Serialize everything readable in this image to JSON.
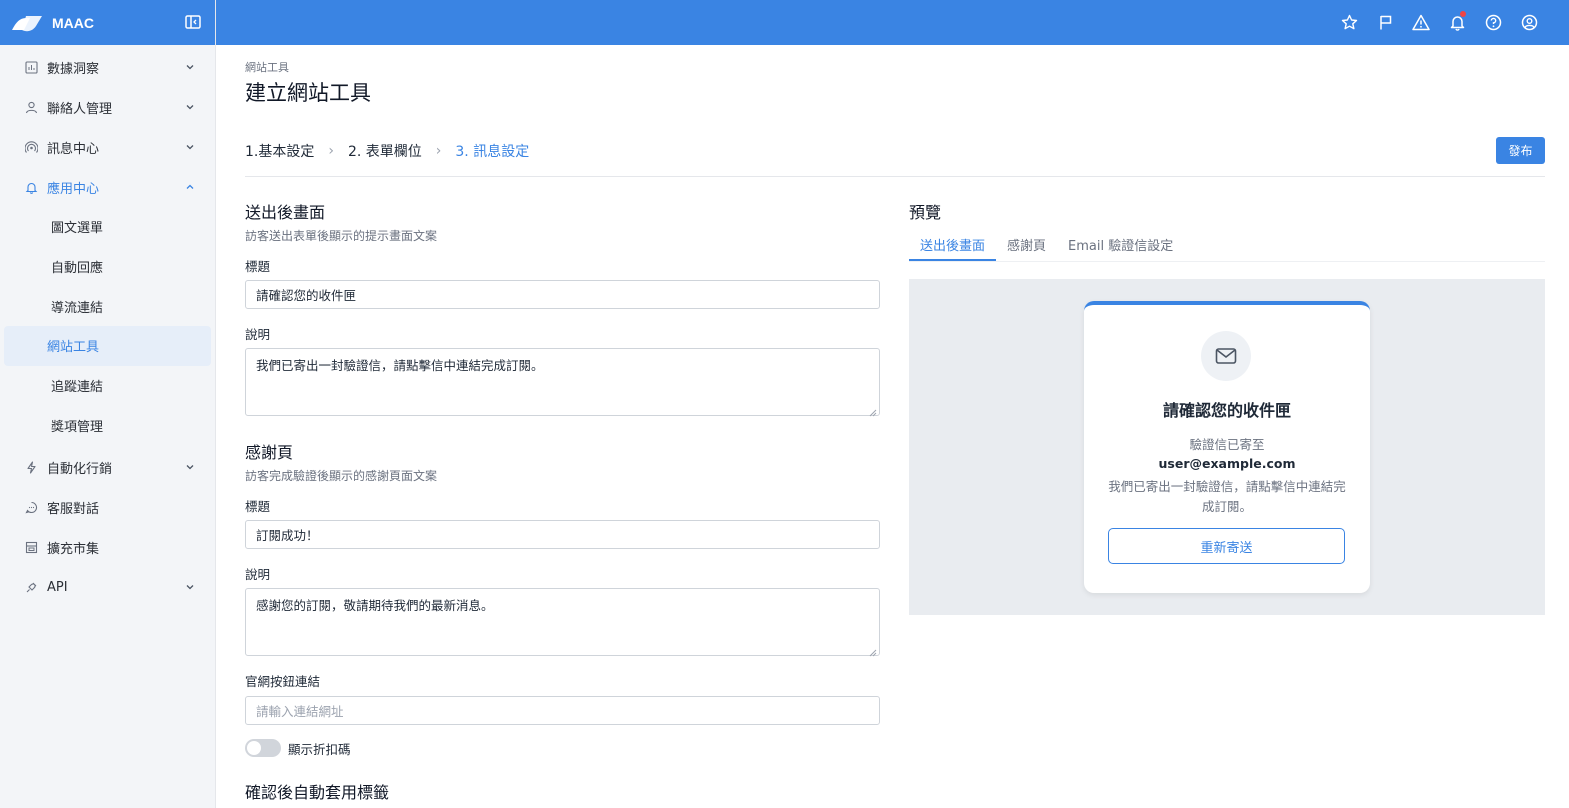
{
  "app": {
    "name": "MAAC"
  },
  "sidebar": {
    "items": [
      {
        "label": "數據洞察",
        "icon": "chart-icon"
      },
      {
        "label": "聯絡人管理",
        "icon": "user-icon"
      },
      {
        "label": "訊息中心",
        "icon": "broadcast-icon"
      },
      {
        "label": "應用中心",
        "icon": "bell-icon"
      },
      {
        "label": "自動化行銷",
        "icon": "lightning-icon"
      },
      {
        "label": "客服對話",
        "icon": "chat-icon"
      },
      {
        "label": "擴充市集",
        "icon": "store-icon"
      },
      {
        "label": "API",
        "icon": "plug-icon"
      }
    ],
    "sub_items": [
      {
        "label": "圖文選單"
      },
      {
        "label": "自動回應"
      },
      {
        "label": "導流連結"
      },
      {
        "label": "網站工具"
      },
      {
        "label": "追蹤連結"
      },
      {
        "label": "獎項管理"
      }
    ]
  },
  "topbar": {
    "icons": [
      "star-icon",
      "flag-icon",
      "warning-icon",
      "bell-icon",
      "help-icon",
      "account-icon"
    ]
  },
  "page": {
    "breadcrumb": "網站工具",
    "title": "建立網站工具",
    "steps": [
      "1.基本設定",
      "2. 表單欄位",
      "3. 訊息設定"
    ],
    "publish_label": "發布"
  },
  "form": {
    "after_submit": {
      "title": "送出後畫面",
      "desc": "訪客送出表單後顯示的提示畫面文案",
      "title_label": "標題",
      "title_value": "請確認您的收件匣",
      "desc_label": "說明",
      "desc_value": "我們已寄出一封驗證信，請點擊信中連結完成訂閱。"
    },
    "thanks": {
      "title": "感謝頁",
      "desc": "訪客完成驗證後顯示的感謝頁面文案",
      "title_label": "標題",
      "title_value": "訂閱成功！",
      "desc_label": "說明",
      "desc_value": "感謝您的訂閱，敬請期待我們的最新消息。",
      "link_label": "官網按鈕連結",
      "link_placeholder": "請輸入連結網址",
      "toggle_label": "顯示折扣碼",
      "toggle_on": false
    },
    "auto_tag_title": "確認後自動套用標籤"
  },
  "preview": {
    "title": "預覽",
    "tabs": [
      "送出後畫面",
      "感謝頁",
      "Email 驗證信設定"
    ],
    "active_tab": 0,
    "card": {
      "title": "請確認您的收件匣",
      "sub": "驗證信已寄至",
      "email": "user@example.com",
      "body": "我們已寄出一封驗證信，請點擊信中連結完成訂閱。",
      "button": "重新寄送"
    }
  },
  "colors": {
    "primary": "#3a84e3"
  }
}
